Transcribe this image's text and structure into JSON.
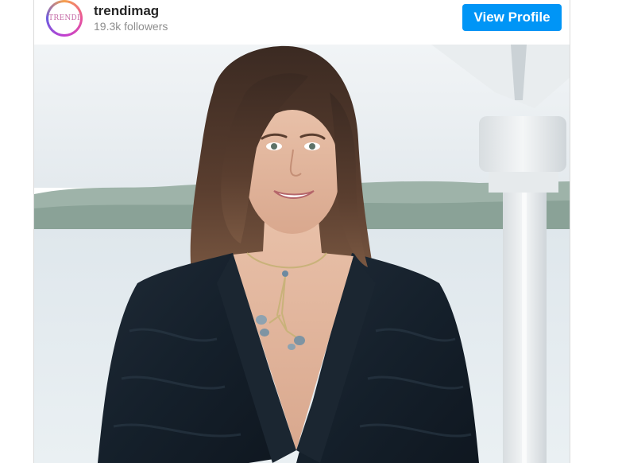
{
  "post": {
    "account": {
      "avatar_text": "TRENDI",
      "username": "trendimag",
      "followers": "19.3k followers"
    },
    "view_profile_label": "View Profile",
    "photo": {
      "alt": "Portrait of a smiling woman with shoulder-length brown hair wearing a dark patterned blazer and a geometric pendant necklace, with a lake and a white porch column in the background"
    }
  },
  "colors": {
    "button": "#0095f6",
    "username": "#262626",
    "followers": "#8e8e8e",
    "border": "#dbdbdb"
  }
}
